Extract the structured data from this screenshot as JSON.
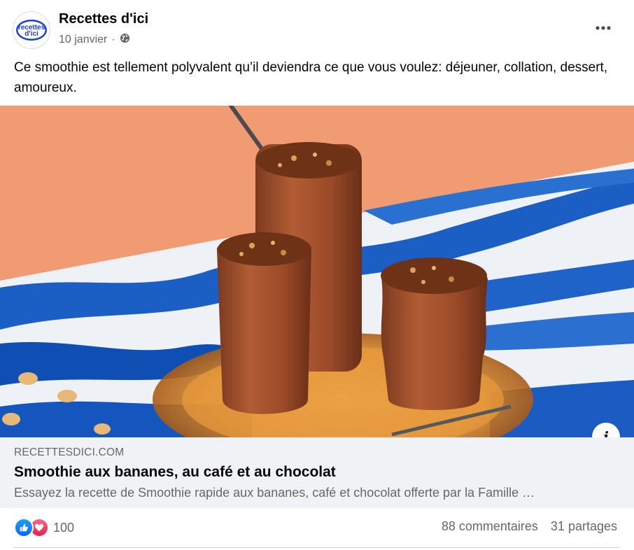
{
  "post": {
    "page_name": "Recettes d'ici",
    "avatar_text_line1": "recettes",
    "avatar_text_line2": "d'ici",
    "date": "10 janvier",
    "separator": "·",
    "privacy_icon": "globe-icon",
    "more_icon": "more-horizontal-icon",
    "text": "Ce smoothie est tellement polyvalent qu’il deviendra ce que vous voulez: déjeuner, collation, dessert, amoureux."
  },
  "link_preview": {
    "domain": "RECETTESDICI.COM",
    "title": "Smoothie aux bananes, au café et au chocolat",
    "description": "Essayez la recette de Smoothie rapide aux bananes, café et chocolat offerte par la Famille …",
    "info_label": "i"
  },
  "engagement": {
    "reaction_icons": [
      "like-icon",
      "love-icon"
    ],
    "reaction_count": "100",
    "comments": "88 commentaires",
    "shares": "31 partages"
  },
  "colors": {
    "like_blue": "#0866ff",
    "love_red": "#e61e4d",
    "avatar_blue": "#1b3fd6",
    "secondary_text": "#65676b",
    "preview_bg": "#f0f2f5"
  }
}
